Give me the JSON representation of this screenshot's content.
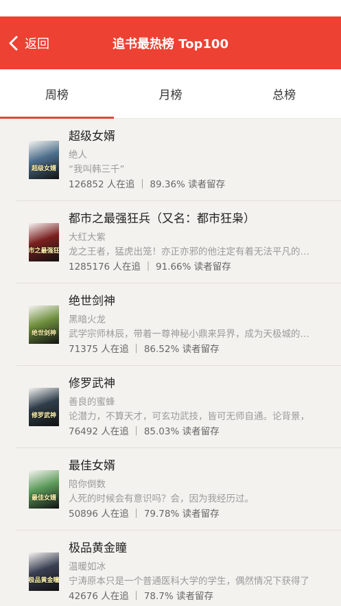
{
  "header": {
    "back_label": "返回",
    "title": "追书最热榜 Top100",
    "accent_color": "#ec4133"
  },
  "tabs": [
    {
      "label": "周榜",
      "active": true
    },
    {
      "label": "月榜",
      "active": false
    },
    {
      "label": "总榜",
      "active": false
    }
  ],
  "books": [
    {
      "title": "超级女婿",
      "author": "绝人",
      "desc": "“我叫韩三千”",
      "stats": "126852 人在追 ｜ 89.36% 读者留存",
      "cover_text": "超级女婿",
      "cover_color": "#4d6f8c"
    },
    {
      "title": "都市之最强狂兵（又名：都市狂枭）",
      "author": "大红大紫",
      "desc": "龙之王者，猛虎出笼！亦正亦邪的他注定有着无法平凡的人生",
      "stats": "1285176 人在追 ｜ 91.66% 读者留存",
      "cover_text": "都市之最强狂兵",
      "cover_color": "#7a1f1f"
    },
    {
      "title": "绝世剑神",
      "author": "黑暗火龙",
      "desc": "武学宗师林辰，带着一尊神秘小鼎来异界，成为天极城的一名",
      "stats": "71375 人在追 ｜ 86.52% 读者留存",
      "cover_text": "绝世剑神",
      "cover_color": "#6e8f3c"
    },
    {
      "title": "修罗武神",
      "author": "善良的蜜蜂",
      "desc": "论潜力，不算天才，可玄功武技，皆可无师自通。论背景，",
      "stats": "76492 人在追 ｜ 85.03% 读者留存",
      "cover_text": "修罗武神",
      "cover_color": "#2f3d4a"
    },
    {
      "title": "最佳女婿",
      "author": "陪你倒数",
      "desc": "人死的时候会有意识吗？会，因为我经历过。",
      "stats": "50896 人在追 ｜ 79.78% 读者留存",
      "cover_text": "最佳女婿",
      "cover_color": "#5c9b5a"
    },
    {
      "title": "极品黄金瞳",
      "author": "温暖如冰",
      "desc": "宁涛原本只是一个普通医科大学的学生，偶然情况下获得了",
      "stats": "42676 人在追 ｜ 78.7% 读者留存",
      "cover_text": "极品黄金瞳",
      "cover_color": "#3a3f52"
    }
  ]
}
